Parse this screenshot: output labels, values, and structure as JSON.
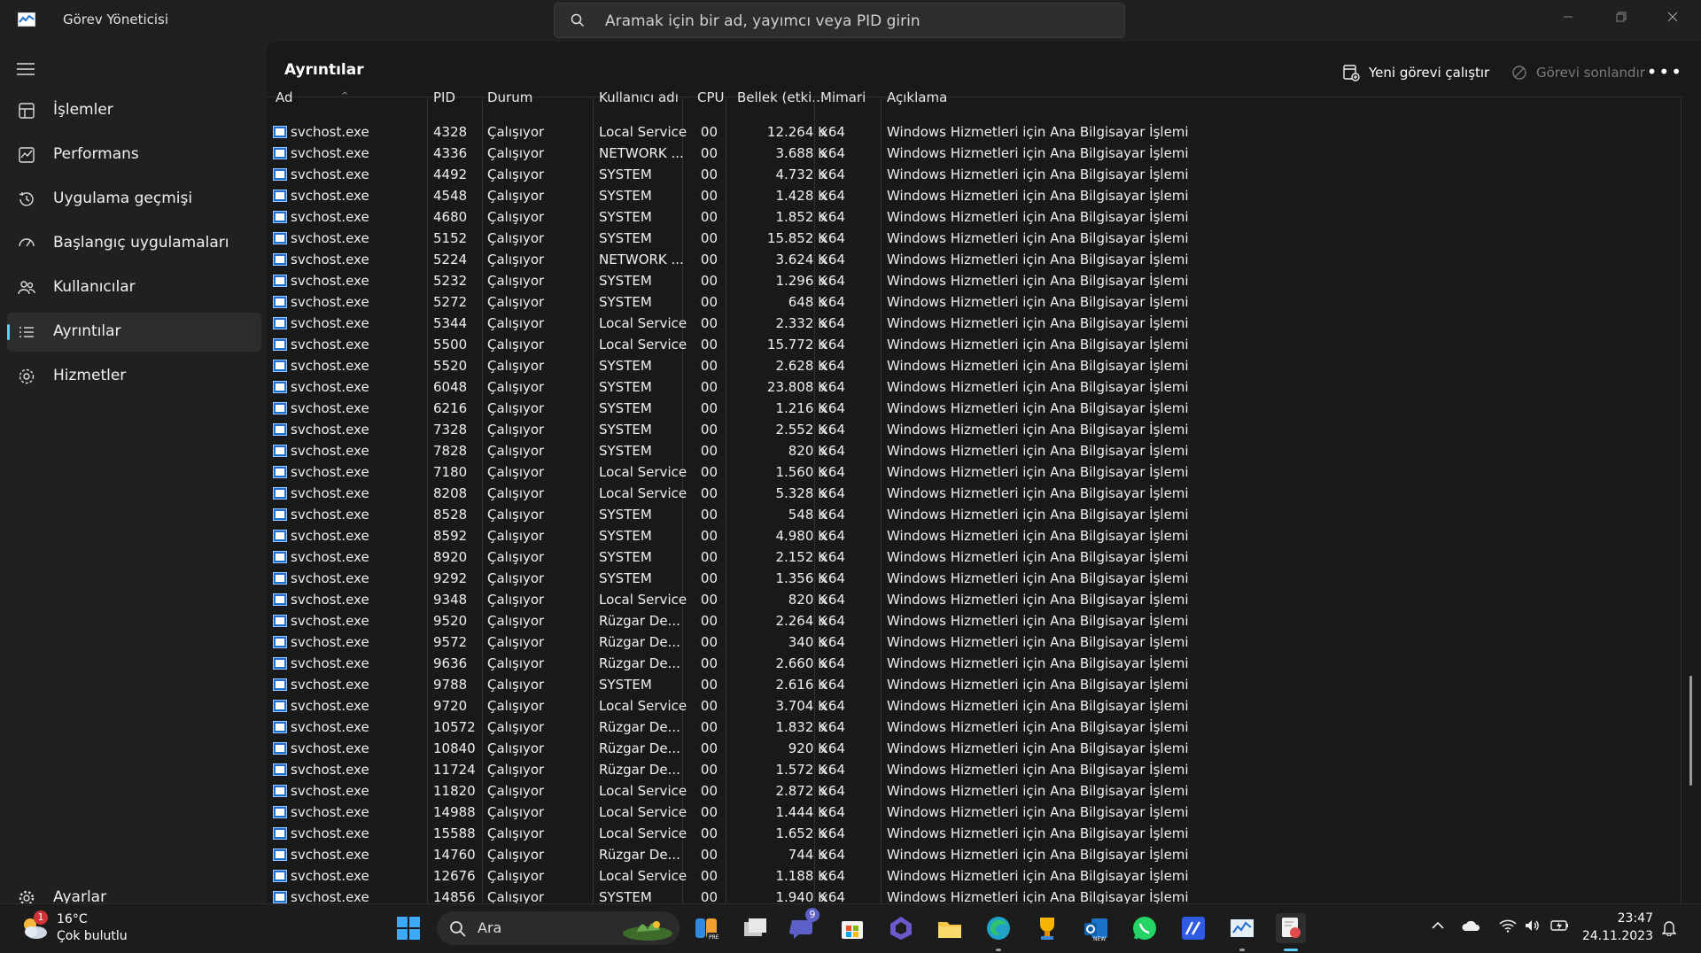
{
  "window": {
    "title": "Görev Yöneticisi",
    "search_placeholder": "Aramak için bir ad, yayımcı veya PID girin"
  },
  "sidebar": {
    "items": [
      {
        "label": "İşlemler",
        "icon": "processes-icon"
      },
      {
        "label": "Performans",
        "icon": "performance-icon"
      },
      {
        "label": "Uygulama geçmişi",
        "icon": "app-history-icon"
      },
      {
        "label": "Başlangıç uygulamaları",
        "icon": "startup-icon"
      },
      {
        "label": "Kullanıcılar",
        "icon": "users-icon"
      },
      {
        "label": "Ayrıntılar",
        "icon": "details-icon",
        "active": true
      },
      {
        "label": "Hizmetler",
        "icon": "services-icon"
      }
    ],
    "settings_label": "Ayarlar"
  },
  "toolbar": {
    "page_title": "Ayrıntılar",
    "run_new_task": "Yeni görevi çalıştır",
    "end_task": "Görevi sonlandır"
  },
  "table": {
    "columns": [
      "Ad",
      "PID",
      "Durum",
      "Kullanıcı adı",
      "CPU",
      "Bellek (etki...",
      "Mimari",
      "Açıklama"
    ],
    "rows": [
      [
        "svchost.exe",
        "4328",
        "Çalışıyor",
        "Local Service",
        "00",
        "12.264 K",
        "x64",
        "Windows Hizmetleri için Ana Bilgisayar İşlemi"
      ],
      [
        "svchost.exe",
        "4336",
        "Çalışıyor",
        "NETWORK ...",
        "00",
        "3.688 K",
        "x64",
        "Windows Hizmetleri için Ana Bilgisayar İşlemi"
      ],
      [
        "svchost.exe",
        "4492",
        "Çalışıyor",
        "SYSTEM",
        "00",
        "4.732 K",
        "x64",
        "Windows Hizmetleri için Ana Bilgisayar İşlemi"
      ],
      [
        "svchost.exe",
        "4548",
        "Çalışıyor",
        "SYSTEM",
        "00",
        "1.428 K",
        "x64",
        "Windows Hizmetleri için Ana Bilgisayar İşlemi"
      ],
      [
        "svchost.exe",
        "4680",
        "Çalışıyor",
        "SYSTEM",
        "00",
        "1.852 K",
        "x64",
        "Windows Hizmetleri için Ana Bilgisayar İşlemi"
      ],
      [
        "svchost.exe",
        "5152",
        "Çalışıyor",
        "SYSTEM",
        "00",
        "15.852 K",
        "x64",
        "Windows Hizmetleri için Ana Bilgisayar İşlemi"
      ],
      [
        "svchost.exe",
        "5224",
        "Çalışıyor",
        "NETWORK ...",
        "00",
        "3.624 K",
        "x64",
        "Windows Hizmetleri için Ana Bilgisayar İşlemi"
      ],
      [
        "svchost.exe",
        "5232",
        "Çalışıyor",
        "SYSTEM",
        "00",
        "1.296 K",
        "x64",
        "Windows Hizmetleri için Ana Bilgisayar İşlemi"
      ],
      [
        "svchost.exe",
        "5272",
        "Çalışıyor",
        "SYSTEM",
        "00",
        "648 K",
        "x64",
        "Windows Hizmetleri için Ana Bilgisayar İşlemi"
      ],
      [
        "svchost.exe",
        "5344",
        "Çalışıyor",
        "Local Service",
        "00",
        "2.332 K",
        "x64",
        "Windows Hizmetleri için Ana Bilgisayar İşlemi"
      ],
      [
        "svchost.exe",
        "5500",
        "Çalışıyor",
        "Local Service",
        "00",
        "15.772 K",
        "x64",
        "Windows Hizmetleri için Ana Bilgisayar İşlemi"
      ],
      [
        "svchost.exe",
        "5520",
        "Çalışıyor",
        "SYSTEM",
        "00",
        "2.628 K",
        "x64",
        "Windows Hizmetleri için Ana Bilgisayar İşlemi"
      ],
      [
        "svchost.exe",
        "6048",
        "Çalışıyor",
        "SYSTEM",
        "00",
        "23.808 K",
        "x64",
        "Windows Hizmetleri için Ana Bilgisayar İşlemi"
      ],
      [
        "svchost.exe",
        "6216",
        "Çalışıyor",
        "SYSTEM",
        "00",
        "1.216 K",
        "x64",
        "Windows Hizmetleri için Ana Bilgisayar İşlemi"
      ],
      [
        "svchost.exe",
        "7328",
        "Çalışıyor",
        "SYSTEM",
        "00",
        "2.552 K",
        "x64",
        "Windows Hizmetleri için Ana Bilgisayar İşlemi"
      ],
      [
        "svchost.exe",
        "7828",
        "Çalışıyor",
        "SYSTEM",
        "00",
        "820 K",
        "x64",
        "Windows Hizmetleri için Ana Bilgisayar İşlemi"
      ],
      [
        "svchost.exe",
        "7180",
        "Çalışıyor",
        "Local Service",
        "00",
        "1.560 K",
        "x64",
        "Windows Hizmetleri için Ana Bilgisayar İşlemi"
      ],
      [
        "svchost.exe",
        "8208",
        "Çalışıyor",
        "Local Service",
        "00",
        "5.328 K",
        "x64",
        "Windows Hizmetleri için Ana Bilgisayar İşlemi"
      ],
      [
        "svchost.exe",
        "8528",
        "Çalışıyor",
        "SYSTEM",
        "00",
        "548 K",
        "x64",
        "Windows Hizmetleri için Ana Bilgisayar İşlemi"
      ],
      [
        "svchost.exe",
        "8592",
        "Çalışıyor",
        "SYSTEM",
        "00",
        "4.980 K",
        "x64",
        "Windows Hizmetleri için Ana Bilgisayar İşlemi"
      ],
      [
        "svchost.exe",
        "8920",
        "Çalışıyor",
        "SYSTEM",
        "00",
        "2.152 K",
        "x64",
        "Windows Hizmetleri için Ana Bilgisayar İşlemi"
      ],
      [
        "svchost.exe",
        "9292",
        "Çalışıyor",
        "SYSTEM",
        "00",
        "1.356 K",
        "x64",
        "Windows Hizmetleri için Ana Bilgisayar İşlemi"
      ],
      [
        "svchost.exe",
        "9348",
        "Çalışıyor",
        "Local Service",
        "00",
        "820 K",
        "x64",
        "Windows Hizmetleri için Ana Bilgisayar İşlemi"
      ],
      [
        "svchost.exe",
        "9520",
        "Çalışıyor",
        "Rüzgar De...",
        "00",
        "2.264 K",
        "x64",
        "Windows Hizmetleri için Ana Bilgisayar İşlemi"
      ],
      [
        "svchost.exe",
        "9572",
        "Çalışıyor",
        "Rüzgar De...",
        "00",
        "340 K",
        "x64",
        "Windows Hizmetleri için Ana Bilgisayar İşlemi"
      ],
      [
        "svchost.exe",
        "9636",
        "Çalışıyor",
        "Rüzgar De...",
        "00",
        "2.660 K",
        "x64",
        "Windows Hizmetleri için Ana Bilgisayar İşlemi"
      ],
      [
        "svchost.exe",
        "9788",
        "Çalışıyor",
        "SYSTEM",
        "00",
        "2.616 K",
        "x64",
        "Windows Hizmetleri için Ana Bilgisayar İşlemi"
      ],
      [
        "svchost.exe",
        "9720",
        "Çalışıyor",
        "Local Service",
        "00",
        "3.704 K",
        "x64",
        "Windows Hizmetleri için Ana Bilgisayar İşlemi"
      ],
      [
        "svchost.exe",
        "10572",
        "Çalışıyor",
        "Rüzgar De...",
        "00",
        "1.832 K",
        "x64",
        "Windows Hizmetleri için Ana Bilgisayar İşlemi"
      ],
      [
        "svchost.exe",
        "10840",
        "Çalışıyor",
        "Rüzgar De...",
        "00",
        "920 K",
        "x64",
        "Windows Hizmetleri için Ana Bilgisayar İşlemi"
      ],
      [
        "svchost.exe",
        "11724",
        "Çalışıyor",
        "Rüzgar De...",
        "00",
        "1.572 K",
        "x64",
        "Windows Hizmetleri için Ana Bilgisayar İşlemi"
      ],
      [
        "svchost.exe",
        "11820",
        "Çalışıyor",
        "Local Service",
        "00",
        "2.872 K",
        "x64",
        "Windows Hizmetleri için Ana Bilgisayar İşlemi"
      ],
      [
        "svchost.exe",
        "14988",
        "Çalışıyor",
        "Local Service",
        "00",
        "1.444 K",
        "x64",
        "Windows Hizmetleri için Ana Bilgisayar İşlemi"
      ],
      [
        "svchost.exe",
        "15588",
        "Çalışıyor",
        "Local Service",
        "00",
        "1.652 K",
        "x64",
        "Windows Hizmetleri için Ana Bilgisayar İşlemi"
      ],
      [
        "svchost.exe",
        "14760",
        "Çalışıyor",
        "Rüzgar De...",
        "00",
        "744 K",
        "x64",
        "Windows Hizmetleri için Ana Bilgisayar İşlemi"
      ],
      [
        "svchost.exe",
        "12676",
        "Çalışıyor",
        "Local Service",
        "00",
        "1.188 K",
        "x64",
        "Windows Hizmetleri için Ana Bilgisayar İşlemi"
      ],
      [
        "svchost.exe",
        "14856",
        "Çalışıyor",
        "SYSTEM",
        "00",
        "1.940 K",
        "x64",
        "Windows Hizmetleri için Ana Bilgisayar İşlemi"
      ]
    ]
  },
  "taskbar": {
    "weather_temp": "16°C",
    "weather_desc": "Çok bulutlu",
    "weather_badge": "1",
    "search_label": "Ara",
    "teams_badge": "9",
    "clock_time": "23:47",
    "clock_date": "24.11.2023"
  },
  "colors": {
    "accent": "#60cdff",
    "background": "#202020",
    "table_bg": "#191919"
  }
}
